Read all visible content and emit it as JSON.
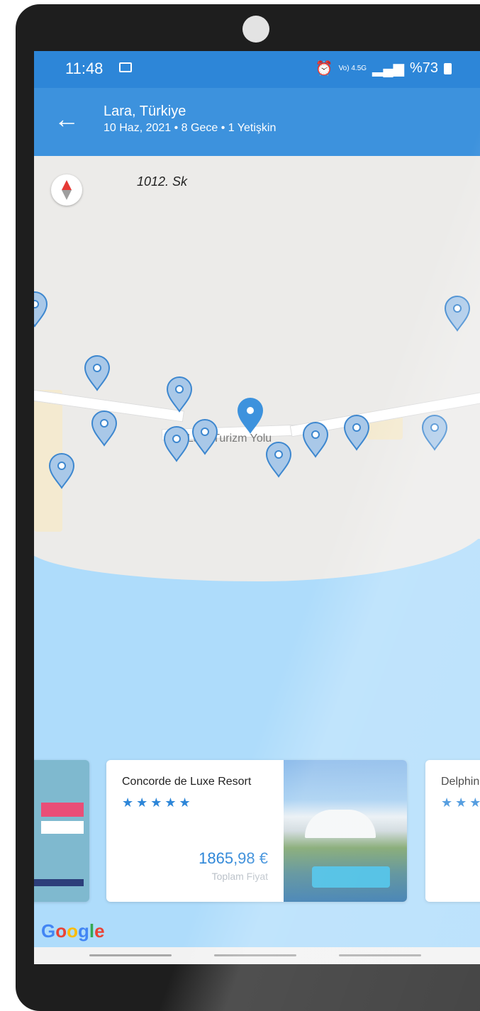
{
  "status_bar": {
    "time": "11:48",
    "network": "Vo) 4.5G",
    "battery": "%73"
  },
  "header": {
    "title": "Lara, Türkiye",
    "subtitle": "10 Haz, 2021 • 8 Gece • 1 Yetişkin"
  },
  "map": {
    "street_label": "1012. Sk",
    "road_label": "Lara Turizm Yolu"
  },
  "cards": [
    {
      "name": "Concorde de Luxe Resort",
      "stars": "★★★★★",
      "price": "1865,98 €",
      "price_label": "Toplam Fiyat"
    },
    {
      "name": "Delphin",
      "stars": "★★★"
    }
  ],
  "map_attribution": {
    "letters": [
      "G",
      "o",
      "o",
      "g",
      "l",
      "e"
    ],
    "colors": [
      "#4285F4",
      "#EA4335",
      "#FBBC05",
      "#4285F4",
      "#34A853",
      "#EA4335"
    ]
  },
  "colors": {
    "primary": "#2d86d8",
    "pin_fill": "#a9c8e8",
    "pin_selected": "#3d92dd"
  }
}
